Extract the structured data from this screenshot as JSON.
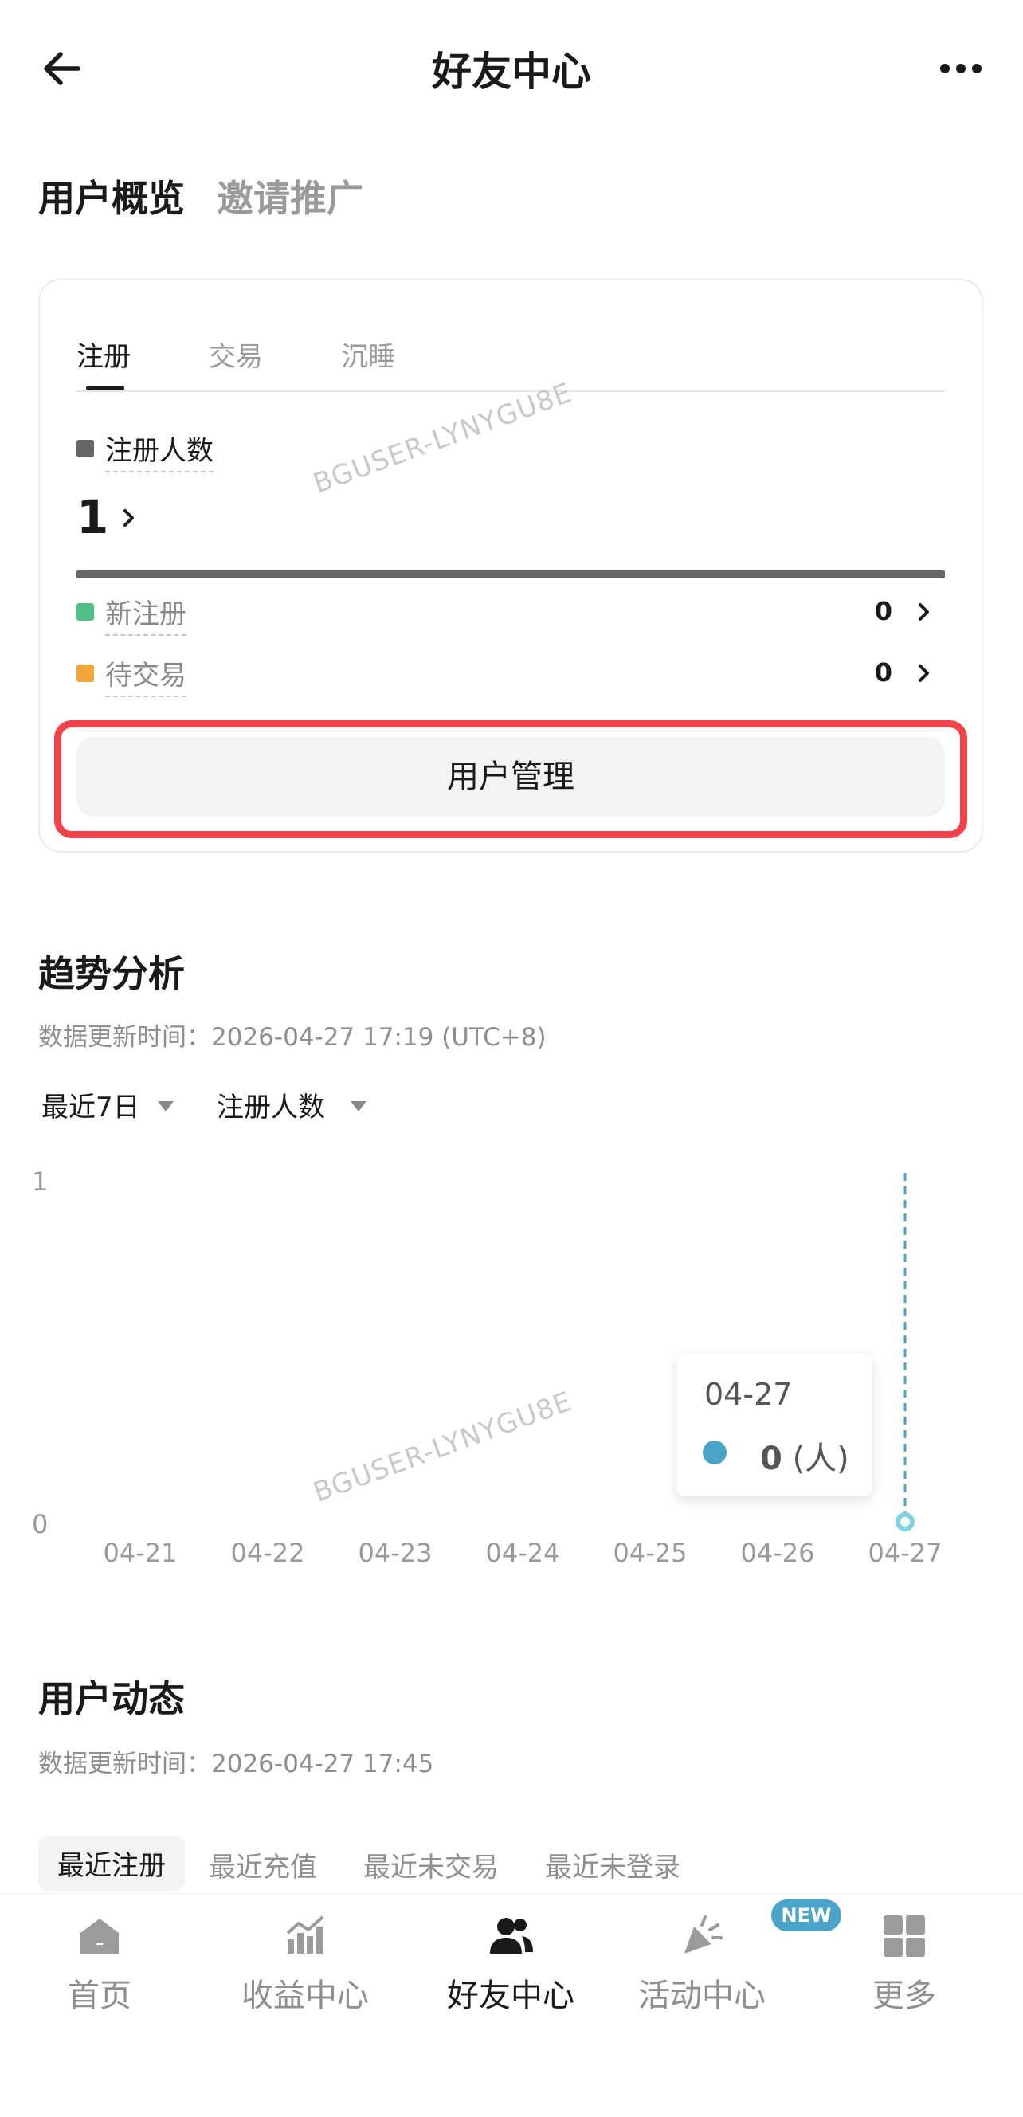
{
  "header": {
    "title": "好友中心"
  },
  "top_tabs": [
    {
      "label": "用户概览",
      "active": true
    },
    {
      "label": "邀请推广",
      "active": false
    }
  ],
  "card": {
    "tabs": [
      "注册",
      "交易",
      "沉睡"
    ],
    "total_label": "注册人数",
    "total_value": "1",
    "rows": [
      {
        "label": "新注册",
        "value": "0",
        "color": "#4dbf87"
      },
      {
        "label": "待交易",
        "value": "0",
        "color": "#f0a63a"
      }
    ],
    "button_label": "用户管理",
    "total_color": "#666666"
  },
  "watermark": "BGUSER-LYNYGU8E",
  "trend": {
    "title": "趋势分析",
    "updated": "数据更新时间：2026-04-27 17:19 (UTC+8)",
    "filter_range": "最近7日",
    "filter_metric": "注册人数"
  },
  "chart_data": {
    "type": "line",
    "categories": [
      "04-21",
      "04-22",
      "04-23",
      "04-24",
      "04-25",
      "04-26",
      "04-27"
    ],
    "series": [
      {
        "values": [
          0,
          0,
          0,
          0,
          0,
          0,
          0
        ]
      }
    ],
    "y_ticks": [
      "1",
      "0"
    ],
    "ylim": [
      0,
      1
    ],
    "grid": false,
    "tooltip": {
      "date": "04-27",
      "value": "0",
      "unit": "(人)"
    },
    "line_color": "#4aa3c8"
  },
  "dynamics": {
    "title": "用户动态",
    "updated": "数据更新时间：2026-04-27 17:45",
    "tabs": [
      "最近注册",
      "最近充值",
      "最近未交易",
      "最近未登录"
    ]
  },
  "nav": {
    "items": [
      {
        "label": "首页",
        "icon": "home-icon"
      },
      {
        "label": "收益中心",
        "icon": "earnings-chart-icon"
      },
      {
        "label": "好友中心",
        "icon": "friends-icon"
      },
      {
        "label": "活动中心",
        "icon": "party-popper-icon"
      },
      {
        "label": "更多",
        "icon": "grid-icon"
      }
    ],
    "active_index": 2,
    "badge": "NEW"
  }
}
